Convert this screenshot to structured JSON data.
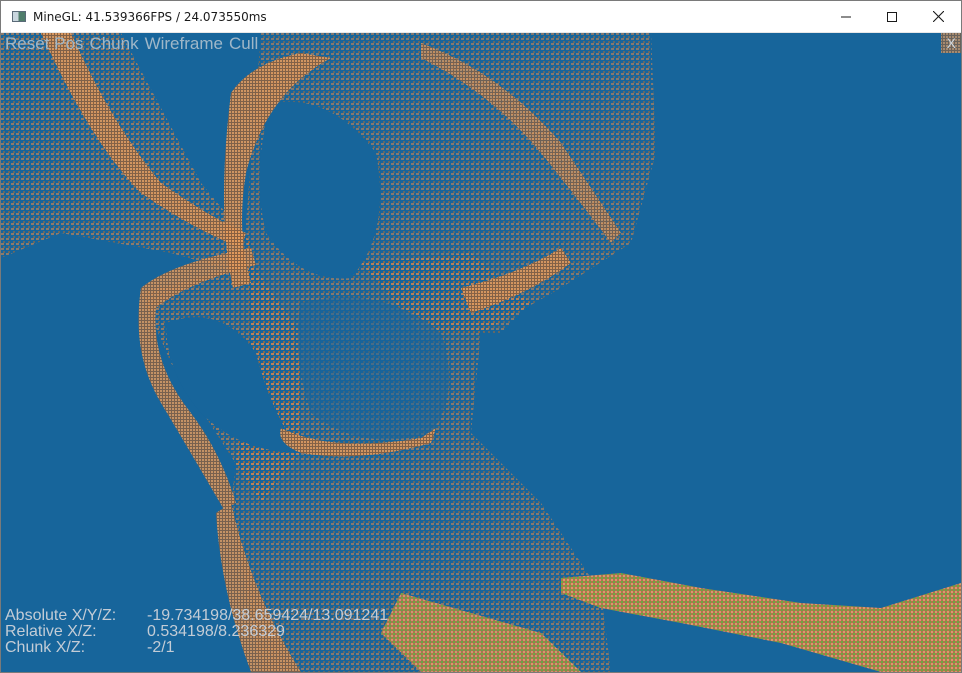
{
  "window": {
    "title": "MineGL: 41.539366FPS / 24.073550ms",
    "controls": {
      "minimize": "minimize-icon",
      "maximize": "maximize-icon",
      "close": "close-icon"
    }
  },
  "colors": {
    "sky": "#17659b",
    "terrain_orange": "#d9894f",
    "terrain_dark": "#7a5a3a",
    "grass": "#6fae3a",
    "overlay_text": "#9fb7c8"
  },
  "menu": {
    "items": [
      "Reset Pos",
      "Chunk",
      "Wireframe",
      "Cull"
    ],
    "close_glyph": "X"
  },
  "info": {
    "absolute_label": "Absolute X/Y/Z:",
    "absolute_value": "-19.734198/38.659424/13.091241",
    "relative_label": "Relative X/Z:",
    "relative_value": "0.534198/8.236329",
    "chunk_label": "Chunk X/Z:",
    "chunk_value": "-2/1"
  }
}
